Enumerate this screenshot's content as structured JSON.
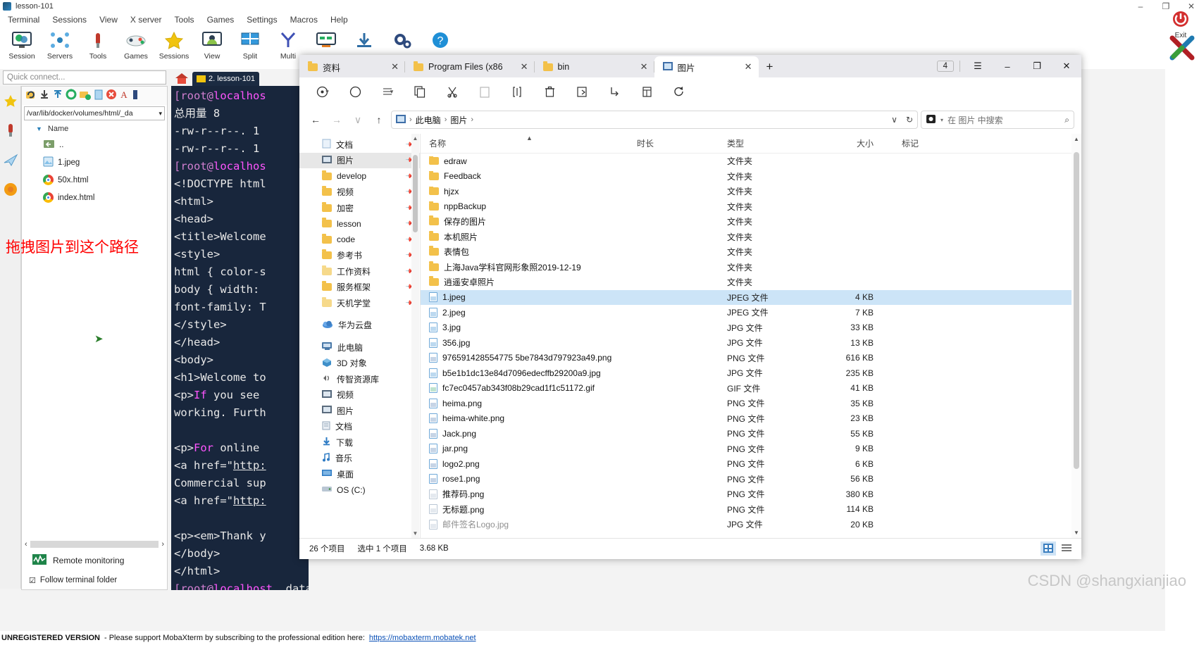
{
  "moba": {
    "window_title": "lesson-101",
    "window_controls": [
      "–",
      "❐",
      "✕"
    ],
    "menu": [
      "Terminal",
      "Sessions",
      "View",
      "X server",
      "Tools",
      "Games",
      "Settings",
      "Macros",
      "Help"
    ],
    "ribbon": [
      {
        "label": "Session",
        "icon": "session-icon"
      },
      {
        "label": "Servers",
        "icon": "servers-icon"
      },
      {
        "label": "Tools",
        "icon": "tools-icon"
      },
      {
        "label": "Games",
        "icon": "games-icon"
      },
      {
        "label": "Sessions",
        "icon": "star-icon"
      },
      {
        "label": "View",
        "icon": "view-icon"
      },
      {
        "label": "Split",
        "icon": "split-icon"
      },
      {
        "label": "Multi",
        "icon": "multi-icon"
      },
      {
        "label": "",
        "icon": "monitor-icon"
      },
      {
        "label": "",
        "icon": "download-icon"
      },
      {
        "label": "",
        "icon": "settings-gear-icon"
      },
      {
        "label": "",
        "icon": "help-icon"
      }
    ],
    "quick_connect_placeholder": "Quick connect...",
    "sftp": {
      "path": "/var/lib/docker/volumes/html/_da",
      "column_header": "Name",
      "files": [
        {
          "name": "..",
          "icon": "parent-folder-icon"
        },
        {
          "name": "1.jpeg",
          "icon": "image-file-icon"
        },
        {
          "name": "50x.html",
          "icon": "chrome-icon"
        },
        {
          "name": "index.html",
          "icon": "chrome-icon"
        }
      ],
      "remote_monitoring": "Remote monitoring",
      "follow_terminal_folder": "Follow terminal folder"
    },
    "annotation": "拖拽图片到这个路径",
    "terminal_tab": "2. lesson-101",
    "terminal_lines": [
      "[root@localhos",
      "总用量 8",
      "-rw-r--r--. 1",
      "-rw-r--r--. 1",
      "[root@localhos",
      "<!DOCTYPE html",
      "<html>",
      "<head>",
      "<title>Welcome",
      "<style>",
      "html { color-s",
      "body { width:",
      "font-family: T",
      "</style>",
      "</head>",
      "<body>",
      "<h1>Welcome to",
      "<p>If you see",
      "working. Furth",
      "",
      "<p>For online",
      "<a href=\"http:",
      "Commercial sup",
      "<a href=\"http:",
      "",
      "<p><em>Thank y",
      "</body>",
      "</html>",
      "[root@localhost _data]# "
    ],
    "footer": {
      "unregistered": "UNREGISTERED VERSION",
      "message": "- Please support MobaXterm by subscribing to the professional edition here:",
      "link": "https://mobaxterm.mobatek.net"
    },
    "exit_label": "Exit"
  },
  "explorer": {
    "tabs": [
      {
        "label": "资料",
        "icon": "folder-icon",
        "active": false
      },
      {
        "label": "Program Files (x86",
        "icon": "folder-icon",
        "active": false
      },
      {
        "label": "bin",
        "icon": "folder-icon",
        "active": false
      },
      {
        "label": "图片",
        "icon": "pictures-icon",
        "active": true
      }
    ],
    "new_tab_label": "+",
    "tab_count": "4",
    "window_buttons": [
      "☰",
      "–",
      "❐",
      "✕"
    ],
    "toolbar": [
      {
        "name": "new-button",
        "glyph": "⊕",
        "caret": true
      },
      {
        "name": "clipboard-history-button",
        "glyph": "○",
        "caret": false
      },
      {
        "name": "sort-button",
        "glyph": "≡",
        "caret": true
      },
      {
        "name": "copy-button",
        "glyph": "❐",
        "caret": false
      },
      {
        "name": "cut-button",
        "glyph": "✂",
        "caret": false
      },
      {
        "name": "paste-button",
        "glyph": "❐",
        "caret": false,
        "disabled": true
      },
      {
        "name": "rename-button",
        "glyph": "[]",
        "caret": false
      },
      {
        "name": "delete-button",
        "glyph": "Ὕ1",
        "caret": false
      },
      {
        "name": "share-button",
        "glyph": "❐",
        "caret": false
      },
      {
        "name": "properties-button",
        "glyph": "⤵",
        "caret": false
      },
      {
        "name": "view-button",
        "glyph": "▤",
        "caret": false
      },
      {
        "name": "refresh-button",
        "glyph": "↻",
        "caret": false
      }
    ],
    "nav_back": "←",
    "nav_forward": "→",
    "nav_recent": "∨",
    "nav_up": "↑",
    "breadcrumb": [
      "此电脑",
      "图片"
    ],
    "breadcrumb_icon": "pictures-icon",
    "address_dropdown": "∨",
    "address_refresh": "↻",
    "search_scope_icon": "search-scope-icon",
    "search_placeholder": "在 图片 中搜索",
    "search_icon": "search-icon",
    "nav_tree": [
      {
        "label": "文档",
        "icon": "doc-icon",
        "selected": false,
        "pinned": true
      },
      {
        "label": "图片",
        "icon": "pictures-icon",
        "selected": true,
        "pinned": true
      },
      {
        "label": "develop",
        "icon": "folder-icon",
        "selected": false,
        "pinned": true
      },
      {
        "label": "视频",
        "icon": "folder-icon",
        "selected": false,
        "pinned": true
      },
      {
        "label": "加密",
        "icon": "folder-icon",
        "selected": false,
        "pinned": true
      },
      {
        "label": "lesson",
        "icon": "folder-icon",
        "selected": false,
        "pinned": true
      },
      {
        "label": "code",
        "icon": "folder-icon",
        "selected": false,
        "pinned": true
      },
      {
        "label": "参考书",
        "icon": "folder-icon",
        "selected": false,
        "pinned": true
      },
      {
        "label": "工作资料",
        "icon": "folder-icon",
        "selected": false,
        "pinned": true
      },
      {
        "label": "服务框架",
        "icon": "folder-icon",
        "selected": false,
        "pinned": true
      },
      {
        "label": "天机学堂",
        "icon": "folder-icon",
        "selected": false,
        "pinned": true
      },
      {
        "label": "华为云盘",
        "icon": "cloud-icon",
        "selected": false,
        "pinned": false,
        "gap": true
      },
      {
        "label": "此电脑",
        "icon": "pc-icon",
        "selected": false,
        "pinned": false,
        "gap": true
      },
      {
        "label": "3D 对象",
        "icon": "3d-objects-icon",
        "selected": false,
        "pinned": false
      },
      {
        "label": "传智资源库",
        "icon": "library-icon",
        "selected": false,
        "pinned": false
      },
      {
        "label": "视频",
        "icon": "videos-icon",
        "selected": false,
        "pinned": false
      },
      {
        "label": "图片",
        "icon": "pictures-icon",
        "selected": false,
        "pinned": false
      },
      {
        "label": "文档",
        "icon": "documents-icon",
        "selected": false,
        "pinned": false
      },
      {
        "label": "下载",
        "icon": "downloads-icon",
        "selected": false,
        "pinned": false
      },
      {
        "label": "音乐",
        "icon": "music-icon",
        "selected": false,
        "pinned": false
      },
      {
        "label": "桌面",
        "icon": "desktop-icon",
        "selected": false,
        "pinned": false
      },
      {
        "label": "OS (C:)",
        "icon": "drive-icon",
        "selected": false,
        "pinned": false
      }
    ],
    "columns": {
      "name": "名称",
      "duration": "时长",
      "type": "类型",
      "size": "大小",
      "tags": "标记"
    },
    "rows": [
      {
        "name": "edraw",
        "duration": "",
        "type": "文件夹",
        "size": "",
        "icon": "folder-icon",
        "selected": false
      },
      {
        "name": "Feedback",
        "duration": "",
        "type": "文件夹",
        "size": "",
        "icon": "folder-icon",
        "selected": false
      },
      {
        "name": "hjzx",
        "duration": "",
        "type": "文件夹",
        "size": "",
        "icon": "folder-icon",
        "selected": false
      },
      {
        "name": "nppBackup",
        "duration": "",
        "type": "文件夹",
        "size": "",
        "icon": "folder-icon",
        "selected": false
      },
      {
        "name": "保存的图片",
        "duration": "",
        "type": "文件夹",
        "size": "",
        "icon": "folder-icon",
        "selected": false
      },
      {
        "name": "本机照片",
        "duration": "",
        "type": "文件夹",
        "size": "",
        "icon": "folder-icon",
        "selected": false
      },
      {
        "name": "表情包",
        "duration": "",
        "type": "文件夹",
        "size": "",
        "icon": "folder-icon",
        "selected": false
      },
      {
        "name": "上海Java学科官网形象照2019-12-19",
        "duration": "",
        "type": "文件夹",
        "size": "",
        "icon": "folder-icon",
        "selected": false
      },
      {
        "name": "逍遥安卓照片",
        "duration": "",
        "type": "文件夹",
        "size": "",
        "icon": "folder-icon",
        "selected": false
      },
      {
        "name": "1.jpeg",
        "duration": "",
        "type": "JPEG 文件",
        "size": "4 KB",
        "icon": "jpeg-file-icon",
        "selected": true
      },
      {
        "name": "2.jpeg",
        "duration": "",
        "type": "JPEG 文件",
        "size": "7 KB",
        "icon": "jpeg-file-icon",
        "selected": false
      },
      {
        "name": "3.jpg",
        "duration": "",
        "type": "JPG 文件",
        "size": "33 KB",
        "icon": "jpg-file-icon",
        "selected": false
      },
      {
        "name": "356.jpg",
        "duration": "",
        "type": "JPG 文件",
        "size": "13 KB",
        "icon": "jpg-file-icon",
        "selected": false
      },
      {
        "name": "976591428554775 5be7843d797923a49.png",
        "duration": "",
        "type": "PNG 文件",
        "size": "616 KB",
        "icon": "png-file-icon",
        "selected": false
      },
      {
        "name": "b5e1b1dc13e84d7096edecffb29200a9.jpg",
        "duration": "",
        "type": "JPG 文件",
        "size": "235 KB",
        "icon": "jpg-file-icon",
        "selected": false
      },
      {
        "name": "fc7ec0457ab343f08b29cad1f1c51172.gif",
        "duration": "",
        "type": "GIF 文件",
        "size": "41 KB",
        "icon": "gif-file-icon",
        "selected": false
      },
      {
        "name": "heima.png",
        "duration": "",
        "type": "PNG 文件",
        "size": "35 KB",
        "icon": "png-file-icon",
        "selected": false
      },
      {
        "name": "heima-white.png",
        "duration": "",
        "type": "PNG 文件",
        "size": "23 KB",
        "icon": "png-file-icon",
        "selected": false
      },
      {
        "name": "Jack.png",
        "duration": "",
        "type": "PNG 文件",
        "size": "55 KB",
        "icon": "png-file-icon",
        "selected": false
      },
      {
        "name": "jar.png",
        "duration": "",
        "type": "PNG 文件",
        "size": "9 KB",
        "icon": "png-file-icon",
        "selected": false
      },
      {
        "name": "logo2.png",
        "duration": "",
        "type": "PNG 文件",
        "size": "6 KB",
        "icon": "png-file-icon",
        "selected": false
      },
      {
        "name": "rose1.png",
        "duration": "",
        "type": "PNG 文件",
        "size": "56 KB",
        "icon": "png-file-icon",
        "selected": false
      },
      {
        "name": "推荐码.png",
        "duration": "",
        "type": "PNG 文件",
        "size": "380 KB",
        "icon": "png-file-icon",
        "selected": false
      },
      {
        "name": "无标题.png",
        "duration": "",
        "type": "PNG 文件",
        "size": "114 KB",
        "icon": "png-file-icon",
        "selected": false
      },
      {
        "name": "邮件签名Logo.jpg",
        "duration": "",
        "type": "JPG 文件",
        "size": "20 KB",
        "icon": "jpg-file-icon",
        "selected": false
      }
    ],
    "status": {
      "item_count": "26 个项目",
      "selected": "选中 1 个项目",
      "selected_size": "3.68 KB"
    }
  },
  "watermark": "CSDN @shangxianjiao",
  "colors": {
    "terminal_bg": "#18263c",
    "annotation_red": "#ff0000",
    "selection_blue": "#cce4f7",
    "folder_yellow": "#f3c14a"
  }
}
